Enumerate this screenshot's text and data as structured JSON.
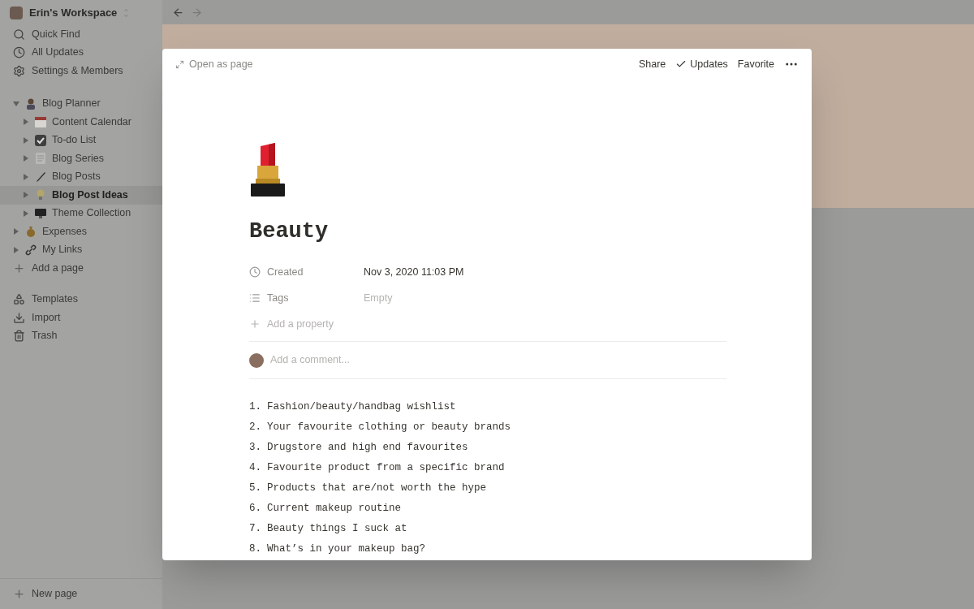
{
  "sidebar": {
    "workspace": "Erin's Workspace",
    "nav": [
      {
        "kind": "search",
        "label": "Quick Find"
      },
      {
        "kind": "clock",
        "label": "All Updates"
      },
      {
        "kind": "gear",
        "label": "Settings & Members"
      }
    ],
    "pages": [
      {
        "kind": "person",
        "label": "Blog Planner",
        "expanded": true,
        "selected": false,
        "children": [
          {
            "kind": "calendar",
            "label": "Content Calendar",
            "expanded": false,
            "selected": false
          },
          {
            "kind": "checkbox",
            "label": "To-do List",
            "expanded": false,
            "selected": false
          },
          {
            "kind": "notepad",
            "label": "Blog Series",
            "expanded": false,
            "selected": false
          },
          {
            "kind": "pen",
            "label": "Blog Posts",
            "expanded": false,
            "selected": false
          },
          {
            "kind": "bulb",
            "label": "Blog Post Ideas",
            "expanded": false,
            "selected": true
          },
          {
            "kind": "monitor",
            "label": "Theme Collection",
            "expanded": false,
            "selected": false
          }
        ]
      },
      {
        "kind": "moneybag",
        "label": "Expenses",
        "expanded": false,
        "selected": false
      },
      {
        "kind": "link",
        "label": "My Links",
        "expanded": false,
        "selected": false
      }
    ],
    "add_page": "Add a page",
    "tools": [
      {
        "kind": "templates",
        "label": "Templates"
      },
      {
        "kind": "import",
        "label": "Import"
      },
      {
        "kind": "trash",
        "label": "Trash"
      }
    ],
    "new_page": "New page"
  },
  "modal": {
    "open_as_page": "Open as page",
    "actions": [
      {
        "kind": "share",
        "label": "Share"
      },
      {
        "kind": "updates",
        "label": "Updates"
      },
      {
        "kind": "favorite",
        "label": "Favorite"
      }
    ],
    "title": "Beauty",
    "properties": [
      {
        "kind": "clock",
        "name": "Created",
        "value": "Nov 3, 2020 11:03 PM",
        "empty": false
      },
      {
        "kind": "list",
        "name": "Tags",
        "value": "Empty",
        "empty": true
      }
    ],
    "add_property": "Add a property",
    "comment_placeholder": "Add a comment...",
    "items": [
      {
        "number": "1.",
        "text": "Fashion/beauty/handbag wishlist"
      },
      {
        "number": "2.",
        "text": "Your favourite clothing or beauty brands"
      },
      {
        "number": "3.",
        "text": "Drugstore and high end favourites"
      },
      {
        "number": "4.",
        "text": "Favourite product from a specific brand"
      },
      {
        "number": "5.",
        "text": "Products that are/not worth the hype"
      },
      {
        "number": "6.",
        "text": "Current makeup routine"
      },
      {
        "number": "7.",
        "text": "Beauty things I suck at"
      },
      {
        "number": "8.",
        "text": "What’s in your makeup bag?"
      }
    ]
  }
}
